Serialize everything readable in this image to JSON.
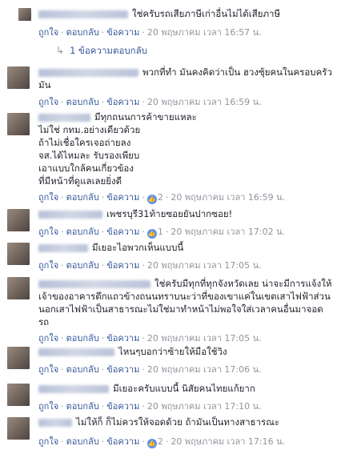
{
  "comments": [
    {
      "text_lines": [
        "ใช่ครับรถเสียภาษีเก่าอื่นไม่ได้เสียภาษี"
      ],
      "like_label": "ถูกใจ",
      "reply_label": "ตอบกลับ",
      "message_label": "ข้อความ",
      "likes": "",
      "time": "20 พฤษภาคม เวลา 16:57 น."
    },
    {
      "text_lines": [
        "พวกที่ทำ มันคงคิดว่าเป็น ฮวงซุ้ยคนในครอบครัว",
        "มัน"
      ],
      "like_label": "ถูกใจ",
      "reply_label": "ตอบกลับ",
      "message_label": "ข้อความ",
      "likes": "",
      "time": "20 พฤษภาคม เวลา 16:59 น."
    },
    {
      "text_lines": [
        "มีทุกถนนการค้าขายแหละ",
        "ไม่ใช่ กทม.อย่างเดียวด้วย",
        "ถ้าไม่เชื่อใครเจอถ่ายลง",
        "จส.ได้ไหมละ รับรองเพียบ",
        "เอาแบบใกล้คนเกี่ยวข้อง",
        "ที่มีหน้าที่ดูแลเลยยิ่งดี"
      ],
      "like_label": "ถูกใจ",
      "reply_label": "ตอบกลับ",
      "message_label": "ข้อความ",
      "likes": "2",
      "time": "20 พฤษภาคม เวลา 16:59 น."
    },
    {
      "text_lines": [
        "เพชรบุรี31ท้ายซอยยันปากซอย!"
      ],
      "like_label": "ถูกใจ",
      "reply_label": "ตอบกลับ",
      "message_label": "ข้อความ",
      "likes": "1",
      "time": "20 พฤษภาคม เวลา 17:02 น."
    },
    {
      "text_lines": [
        "มีเยอะไอพวกเห็นแบบนี้"
      ],
      "like_label": "ถูกใจ",
      "reply_label": "ตอบกลับ",
      "message_label": "ข้อความ",
      "likes": "",
      "time": "20 พฤษภาคม เวลา 17:05 น."
    },
    {
      "text_lines": [
        "ใช่ครับมีทุกที่ทุกจังหวัดเลย น่าจะมีการแจ้งให้",
        "เจ้าของอาคารตึกแถวข้างถนนทราบนะว่าที่ของเขาแค่ในเขตเสาไฟฟ้าส่วน",
        "นอกเสาไฟฟ้าเป็นสาธารณะไม่ใช่มาทำหน้าไม่พอใจใส่เวลาคนอื่นมาจอด",
        "รถ"
      ],
      "like_label": "ถูกใจ",
      "reply_label": "ตอบกลับ",
      "message_label": "ข้อความ",
      "likes": "",
      "time": "20 พฤษภาคม เวลา 17:05 น."
    },
    {
      "text_lines": [
        "ไหนๆบอกว่าซ้ายให้มือใช้วิง"
      ],
      "like_label": "ถูกใจ",
      "reply_label": "ตอบกลับ",
      "message_label": "ข้อความ",
      "likes": "",
      "time": "20 พฤษภาคม เวลา 17:06 น."
    },
    {
      "text_lines": [
        "มีเยอะครับแบบนี้ นิสัยคนไทยแก้ยาก"
      ],
      "like_label": "ถูกใจ",
      "reply_label": "ตอบกลับ",
      "message_label": "ข้อความ",
      "likes": "",
      "time": "20 พฤษภาคม เวลา 17:10 น."
    },
    {
      "text_lines": [
        "ไม่ให้ก็ ก็ไม่ควรให้จอดด้วย ถ้ามันเป็นทางสาธารณะ"
      ],
      "like_label": "ถูกใจ",
      "reply_label": "ตอบกลับ",
      "message_label": "ข้อความ",
      "likes": "2",
      "time": "20 พฤษภาคม เวลา 17:16 น."
    }
  ],
  "reply_summary": "1 ข้อความตอบกลับ",
  "like_icon_glyph": "👍",
  "colors": {
    "link": "#365899",
    "meta": "#90949c",
    "like_badge": "#5890ff"
  }
}
